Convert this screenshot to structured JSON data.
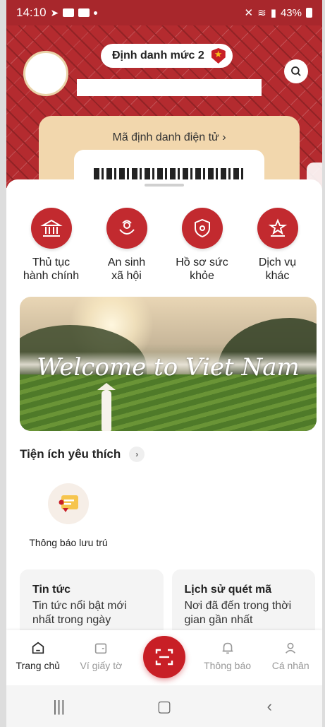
{
  "status_bar": {
    "time": "14:10",
    "battery": "43%"
  },
  "header": {
    "id_level": "Định danh mức 2",
    "id_card_title": "Mã định danh điện tử  ›"
  },
  "services": [
    {
      "label": "Thủ tục\nhành chính",
      "icon": "building-icon"
    },
    {
      "label": "An sinh\nxã hội",
      "icon": "social-care-icon"
    },
    {
      "label": "Hồ sơ sức\nkhỏe",
      "icon": "health-shield-icon"
    },
    {
      "label": "Dịch vụ\nkhác",
      "icon": "more-services-icon"
    }
  ],
  "banner": {
    "caption": "Welcome to Viet Nam"
  },
  "favorites": {
    "title": "Tiện ích yêu thích",
    "items": [
      {
        "label": "Thông báo lưu trú",
        "icon": "residence-notice-icon"
      }
    ]
  },
  "cards": [
    {
      "title": "Tin tức",
      "desc": "Tin tức nổi bật mới nhất trong ngày"
    },
    {
      "title": "Lịch sử quét mã",
      "desc": "Nơi đã đến trong thời gian gần nhất"
    }
  ],
  "bottom_nav": {
    "home": "Trang chủ",
    "wallet": "Ví giấy tờ",
    "notifications": "Thông báo",
    "profile": "Cá nhân"
  },
  "colors": {
    "brand_red": "#c81f26",
    "header_red": "#b42b2f",
    "card_beige": "#f2d7ad"
  }
}
